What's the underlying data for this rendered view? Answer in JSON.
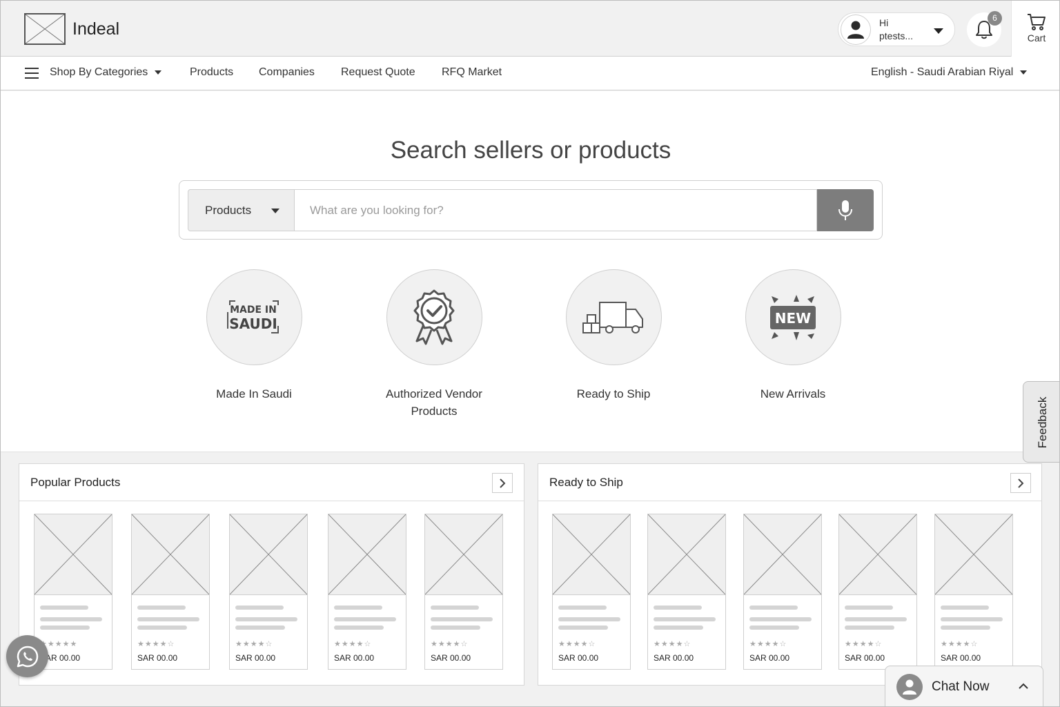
{
  "header": {
    "brand": "Indeal",
    "user": {
      "greeting": "Hi",
      "name": "ptests..."
    },
    "notifications": {
      "count": "6"
    },
    "cart_label": "Cart"
  },
  "nav": {
    "categories_label": "Shop By Categories",
    "items": [
      "Products",
      "Companies",
      "Request Quote",
      "RFQ Market"
    ],
    "locale": "English - Saudi Arabian Riyal"
  },
  "hero": {
    "title": "Search sellers or products",
    "search": {
      "scope": "Products",
      "placeholder": "What are you looking for?"
    },
    "categories": [
      {
        "label": "Made In Saudi",
        "icon": "made-in-saudi-icon",
        "badge_line1": "MADE IN",
        "badge_line2": "SAUDI"
      },
      {
        "label": "Authorized Vendor Products",
        "icon": "award-ribbon-icon"
      },
      {
        "label": "Ready to Ship",
        "icon": "delivery-truck-icon"
      },
      {
        "label": "New Arrivals",
        "icon": "new-burst-icon",
        "badge": "NEW"
      }
    ]
  },
  "panels": [
    {
      "title": "Popular Products",
      "products": [
        {
          "price": "SAR 00.00",
          "rating": 5
        },
        {
          "price": "SAR 00.00",
          "rating": 4
        },
        {
          "price": "SAR 00.00",
          "rating": 4
        },
        {
          "price": "SAR 00.00",
          "rating": 4
        },
        {
          "price": "SAR 00.00",
          "rating": 4
        }
      ]
    },
    {
      "title": "Ready to Ship",
      "products": [
        {
          "price": "SAR 00.00",
          "rating": 4
        },
        {
          "price": "SAR 00.00",
          "rating": 4
        },
        {
          "price": "SAR 00.00",
          "rating": 4
        },
        {
          "price": "SAR 00.00",
          "rating": 4
        },
        {
          "price": "SAR 00.00",
          "rating": 4
        }
      ]
    }
  ],
  "feedback_label": "Feedback",
  "chat_label": "Chat Now",
  "colors": {
    "accent_gray": "#7d7d7d",
    "border": "#cfcfcf",
    "background": "#f1f1f1"
  }
}
